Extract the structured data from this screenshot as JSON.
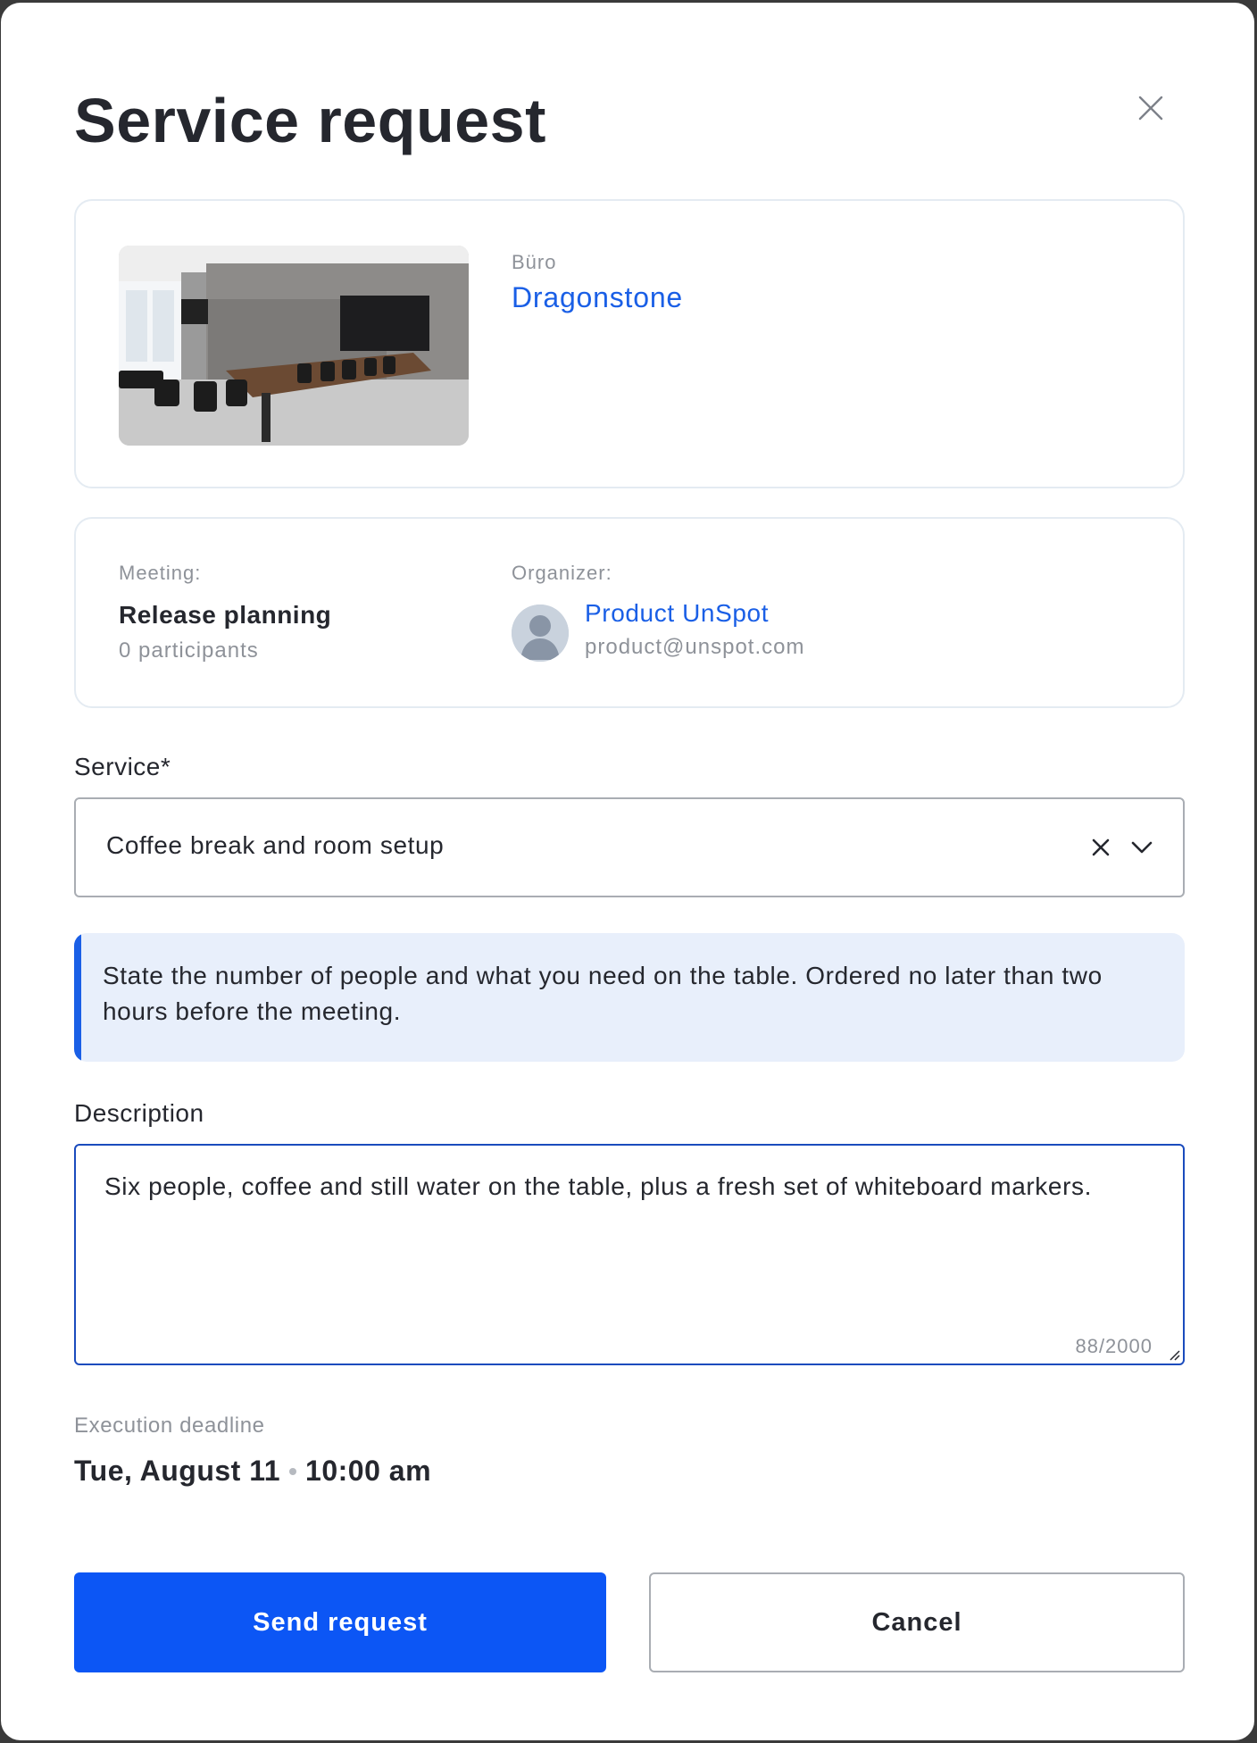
{
  "dialog": {
    "title": "Service request",
    "close_icon": "close-icon"
  },
  "room": {
    "type_label": "Büro",
    "name": "Dragonstone",
    "photo": "conference-room-photo"
  },
  "meeting": {
    "label": "Meeting:",
    "name": "Release planning",
    "participants": "0 participants"
  },
  "organizer": {
    "label": "Organizer:",
    "name": "Product UnSpot",
    "email": "product@unspot.com",
    "avatar_icon": "user-avatar-icon"
  },
  "service": {
    "label": "Service*",
    "value": "Coffee break and room setup",
    "clear_icon": "clear-icon",
    "dropdown_icon": "chevron-down-icon"
  },
  "info": {
    "text": "State the number of people and what you need on the table. Ordered no later than two hours before the meeting."
  },
  "description": {
    "label": "Description",
    "value": "Six people, coffee and still water on the table, plus a fresh set of whiteboard markers.",
    "counter": "88/2000"
  },
  "deadline": {
    "label": "Execution deadline",
    "date": "Tue, August 11",
    "time": "10:00 am"
  },
  "actions": {
    "submit_label": "Send request",
    "cancel_label": "Cancel"
  },
  "colors": {
    "accent": "#0c56f5",
    "link": "#1a5fe6",
    "info_bg": "#e8effb"
  }
}
